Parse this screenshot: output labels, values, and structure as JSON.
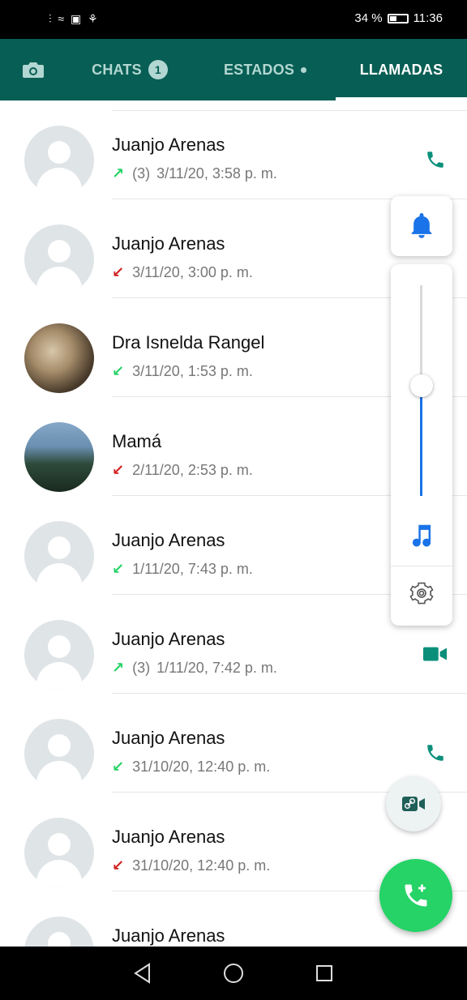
{
  "status_bar": {
    "left_icons": "⫶ ≈ ▣ ⚘",
    "battery": "34 %",
    "time": "11:36"
  },
  "tabs": [
    {
      "label": "CHATS",
      "badge": "1"
    },
    {
      "label": "ESTADOS"
    },
    {
      "label": "LLAMADAS"
    }
  ],
  "calls": [
    {
      "name": "Juanjo Arenas",
      "direction": "outgoing",
      "count": "(3)",
      "time": "3/11/20, 3:58 p. m.",
      "type": "voice"
    },
    {
      "name": "Juanjo Arenas",
      "direction": "missed",
      "count": "",
      "time": "3/11/20, 3:00 p. m.",
      "type": "voice"
    },
    {
      "name": "Dra Isnelda Rangel",
      "direction": "incoming",
      "count": "",
      "time": "3/11/20, 1:53 p. m.",
      "type": "voice"
    },
    {
      "name": "Mamá",
      "direction": "missed",
      "count": "",
      "time": "2/11/20, 2:53 p. m.",
      "type": "voice"
    },
    {
      "name": "Juanjo Arenas",
      "direction": "incoming",
      "count": "",
      "time": "1/11/20, 7:43 p. m.",
      "type": "voice"
    },
    {
      "name": "Juanjo Arenas",
      "direction": "outgoing",
      "count": "(3)",
      "time": "1/11/20, 7:42 p. m.",
      "type": "video"
    },
    {
      "name": "Juanjo Arenas",
      "direction": "incoming",
      "count": "",
      "time": "31/10/20, 12:40 p. m.",
      "type": "voice"
    },
    {
      "name": "Juanjo Arenas",
      "direction": "missed",
      "count": "",
      "time": "31/10/20, 12:40 p. m.",
      "type": "voice"
    },
    {
      "name": "Juanjo Arenas",
      "direction": "",
      "count": "",
      "time": "",
      "type": "voice"
    }
  ],
  "colors": {
    "header": "#075E54",
    "accent": "#25D366",
    "missed": "#d21f1f",
    "volume_blue": "#1a73e8"
  },
  "volume_level": 0.52
}
